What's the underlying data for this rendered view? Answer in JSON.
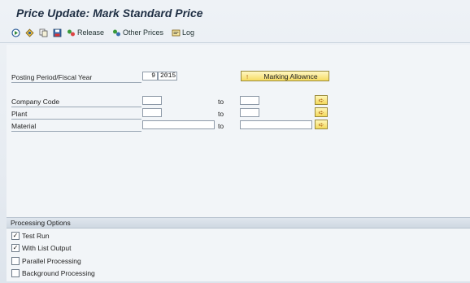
{
  "title": "Price Update: Mark Standard Price",
  "toolbar": {
    "icons": [
      "execute-icon",
      "variants-icon",
      "copy-icon",
      "save-icon"
    ],
    "release_label": "Release",
    "other_prices_label": "Other Prices",
    "log_label": "Log"
  },
  "form": {
    "posting_period_label": "Posting Period/Fiscal Year",
    "period_value": "9",
    "year_value": "2015",
    "marking_button_label": "Marking Allownce",
    "company_code_label": "Company Code",
    "plant_label": "Plant",
    "material_label": "Material",
    "to_label": "to",
    "select_icon": "arrow-right-icon"
  },
  "processing": {
    "header": "Processing Options",
    "options": [
      {
        "label": "Test Run",
        "checked": true
      },
      {
        "label": "With List Output",
        "checked": true
      },
      {
        "label": "Parallel Processing",
        "checked": false
      },
      {
        "label": "Background Processing",
        "checked": false
      }
    ]
  },
  "colors": {
    "accent_button": "#f6dc62",
    "background": "#dfe6ee"
  }
}
